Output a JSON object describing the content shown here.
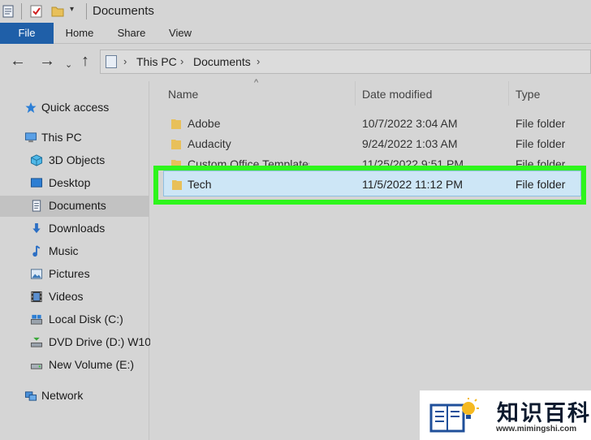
{
  "window": {
    "title": "Documents"
  },
  "ribbon": {
    "tabs": [
      "File",
      "Home",
      "Share",
      "View"
    ]
  },
  "address": {
    "breadcrumb": [
      "This PC",
      "Documents"
    ]
  },
  "sidebar": {
    "items": [
      {
        "label": "Quick access",
        "icon": "star-icon"
      },
      {
        "label": "This PC",
        "icon": "computer-icon"
      },
      {
        "label": "3D Objects",
        "icon": "cube-icon"
      },
      {
        "label": "Desktop",
        "icon": "desktop-icon"
      },
      {
        "label": "Documents",
        "icon": "documents-icon",
        "selected": true
      },
      {
        "label": "Downloads",
        "icon": "download-arrow-icon"
      },
      {
        "label": "Music",
        "icon": "music-note-icon"
      },
      {
        "label": "Pictures",
        "icon": "pictures-icon"
      },
      {
        "label": "Videos",
        "icon": "film-icon"
      },
      {
        "label": "Local Disk (C:)",
        "icon": "local-disk-icon"
      },
      {
        "label": "DVD Drive (D:) W10",
        "icon": "dvd-drive-icon"
      },
      {
        "label": "New Volume (E:)",
        "icon": "drive-icon"
      },
      {
        "label": "Network",
        "icon": "network-icon"
      }
    ]
  },
  "files": {
    "columns": [
      "Name",
      "Date modified",
      "Type"
    ],
    "rows": [
      {
        "name": "Adobe",
        "date": "10/7/2022 3:04 AM",
        "type": "File folder"
      },
      {
        "name": "Audacity",
        "date": "9/24/2022 1:03 AM",
        "type": "File folder"
      },
      {
        "name": "Custom Office Templates",
        "date": "11/25/2022 9:51 PM",
        "type": "File folder"
      },
      {
        "name": "Tech",
        "date": "11/5/2022 11:12 PM",
        "type": "File folder",
        "selected": true
      }
    ]
  },
  "watermark": {
    "text": "知识百科",
    "url": "www.mimingshi.com"
  },
  "colors": {
    "accent": "#1f5fa8",
    "highlight": "#2ef51c",
    "selection": "#cde6f6",
    "folder": "#e8c05a"
  }
}
